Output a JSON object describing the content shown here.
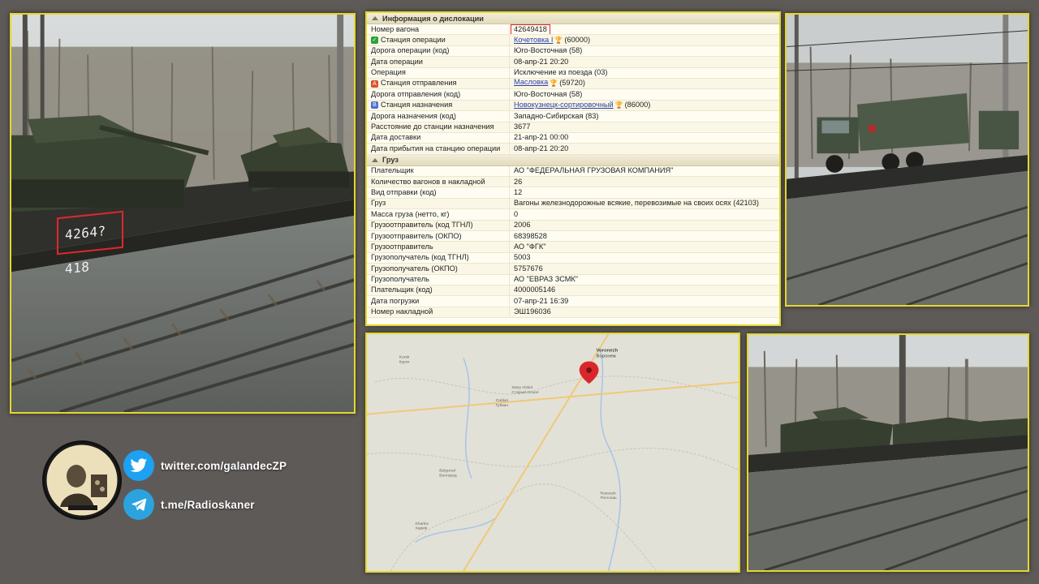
{
  "photos": {
    "tanks_wagon_number": "4264?418"
  },
  "info_table": {
    "header_location": "Информация о дислокации",
    "header_cargo": "Груз",
    "location_rows": [
      {
        "key": "Номер вагона",
        "value": "42649418",
        "highlight": true
      },
      {
        "key": "Станция операции",
        "value": "Кочетовка I",
        "suffix": "(60000)",
        "icon": "green-check",
        "link": true
      },
      {
        "key": "Дорога операции (код)",
        "value": "Юго-Восточная (58)"
      },
      {
        "key": "Дата операции",
        "value": "08-апр-21  20:20"
      },
      {
        "key": "Операция",
        "value": "Исключение из поезда (03)"
      },
      {
        "key": "Станция отправления",
        "value": "Масловка",
        "suffix": "(59720)",
        "icon": "red-a",
        "link": true,
        "underline": true
      },
      {
        "key": "Дорога отправления (код)",
        "value": "Юго-Восточная (58)"
      },
      {
        "key": "Станция назначения",
        "value": "Новокузнецк-сортировочный",
        "suffix": "(86000)",
        "icon": "blue-b",
        "link": true
      },
      {
        "key": "Дорога назначения (код)",
        "value": "Западно-Сибирская (83)"
      },
      {
        "key": "Расстояние до станции назначения",
        "value": "3677"
      },
      {
        "key": "Дата доставки",
        "value": "21-апр-21  00:00"
      },
      {
        "key": "Дата прибытия на станцию операции",
        "value": "08-апр-21  20:20"
      }
    ],
    "cargo_rows": [
      {
        "key": "Плательщик",
        "value": "АО \"ФЕДЕРАЛЬНАЯ ГРУЗОВАЯ КОМПАНИЯ\""
      },
      {
        "key": "Количество вагонов в накладной",
        "value": "26"
      },
      {
        "key": "Вид отправки (код)",
        "value": "12"
      },
      {
        "key": "Груз",
        "value": "Вагоны железнодорожные всякие, перевозимые на своих осях (42103)"
      },
      {
        "key": "Масса груза (нетто, кг)",
        "value": "0"
      },
      {
        "key": "Грузоотправитель (код ТГНЛ)",
        "value": "2006"
      },
      {
        "key": "Грузоотправитель (ОКПО)",
        "value": "68398528"
      },
      {
        "key": "Грузоотправитель",
        "value": "АО \"ФГК\""
      },
      {
        "key": "Грузополучатель (код ТГНЛ)",
        "value": "5003"
      },
      {
        "key": "Грузополучатель (ОКПО)",
        "value": "5757676"
      },
      {
        "key": "Грузополучатель",
        "value": "АО \"ЕВРАЗ ЗСМК\""
      },
      {
        "key": "Плательщик (код)",
        "value": "4000005146"
      },
      {
        "key": "Дата погрузки",
        "value": "07-апр-21  16:39"
      },
      {
        "key": "Номер накладной",
        "value": "ЭШ196036"
      }
    ]
  },
  "map": {
    "labels": [
      {
        "text": "Kursk",
        "sub": "Курск"
      },
      {
        "text": "Voronezh",
        "sub": "Воронеж"
      },
      {
        "text": "Stary Oskol",
        "sub": "Старый Оскол"
      },
      {
        "text": "Gubkin",
        "sub": "Губкин"
      },
      {
        "text": "Belgorod",
        "sub": "Белгород"
      },
      {
        "text": "Kharkiv",
        "sub": "Харків"
      },
      {
        "text": "Rossosh",
        "sub": "Россошь"
      }
    ],
    "pin_color": "#d9262c"
  },
  "social": {
    "twitter": "twitter.com/galandecZP",
    "telegram": "t.me/Radioskaner"
  },
  "colors": {
    "frame": "#e3d82b",
    "background": "#5e5a58",
    "highlight": "#e3262d"
  }
}
